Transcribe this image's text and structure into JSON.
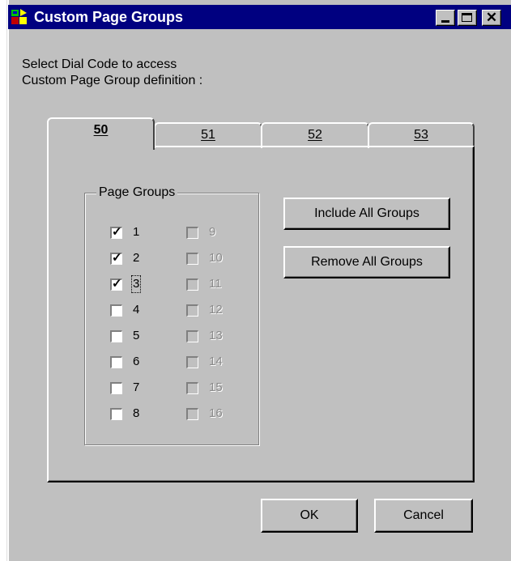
{
  "window": {
    "title": "Custom Page Groups"
  },
  "titlebar_buttons": {
    "minimize": "minimize",
    "maximize": "maximize",
    "close": "✕"
  },
  "prompt": {
    "line1": "Select Dial Code to access",
    "line2": "Custom Page Group definition :"
  },
  "tabs": [
    {
      "label": "50",
      "active": true
    },
    {
      "label": "51",
      "active": false
    },
    {
      "label": "52",
      "active": false
    },
    {
      "label": "53",
      "active": false
    }
  ],
  "page_groups": {
    "label": "Page Groups",
    "left_column": [
      {
        "label": "1",
        "checked": true,
        "enabled": true
      },
      {
        "label": "2",
        "checked": true,
        "enabled": true
      },
      {
        "label": "3",
        "checked": true,
        "enabled": true,
        "focused": true
      },
      {
        "label": "4",
        "checked": false,
        "enabled": true
      },
      {
        "label": "5",
        "checked": false,
        "enabled": true
      },
      {
        "label": "6",
        "checked": false,
        "enabled": true
      },
      {
        "label": "7",
        "checked": false,
        "enabled": true
      },
      {
        "label": "8",
        "checked": false,
        "enabled": true
      }
    ],
    "right_column": [
      {
        "label": "9",
        "checked": false,
        "enabled": false
      },
      {
        "label": "10",
        "checked": false,
        "enabled": false
      },
      {
        "label": "11",
        "checked": false,
        "enabled": false
      },
      {
        "label": "12",
        "checked": false,
        "enabled": false
      },
      {
        "label": "13",
        "checked": false,
        "enabled": false
      },
      {
        "label": "14",
        "checked": false,
        "enabled": false
      },
      {
        "label": "15",
        "checked": false,
        "enabled": false
      },
      {
        "label": "16",
        "checked": false,
        "enabled": false
      }
    ]
  },
  "actions": {
    "include_all": "Include All Groups",
    "remove_all": "Remove All Groups",
    "ok": "OK",
    "cancel": "Cancel"
  },
  "colors": {
    "titlebar": "#000080",
    "face": "#c0c0c0"
  }
}
